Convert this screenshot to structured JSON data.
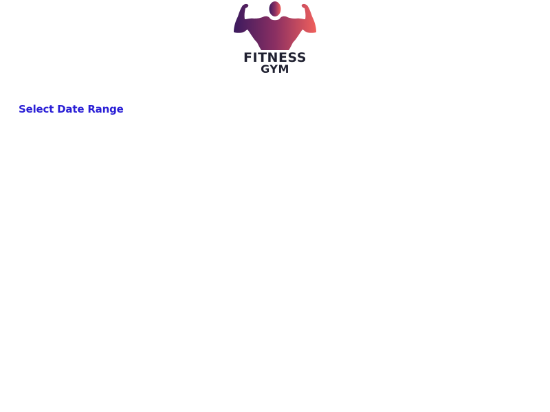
{
  "logo": {
    "icon": "flexing-bodybuilder-icon",
    "line1": "FITNESS",
    "line2": "GYM",
    "gradient_start": "#3b1a5e",
    "gradient_end": "#f0605c"
  },
  "content": {
    "section_title": "Select Date Range",
    "title_color": "#2a1fd6"
  }
}
